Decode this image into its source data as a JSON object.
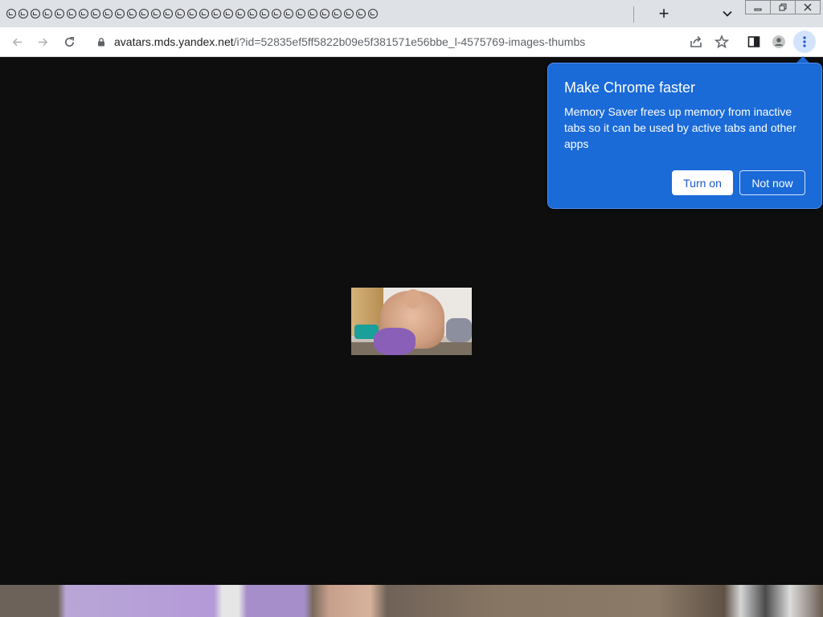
{
  "browser": {
    "tab_count": 31,
    "tab_favicon": "shield-swirl-icon",
    "new_tab_label": "+",
    "url_host": "avatars.mds.yandex.net",
    "url_path": "/i?id=52835ef5ff5822b09e5f381571e56bbe_l-4575769-images-thumbs"
  },
  "icons": {
    "back": "arrow-left-icon",
    "forward": "arrow-right-icon",
    "reload": "reload-icon",
    "lock": "lock-icon",
    "share": "share-icon",
    "bookmark": "star-icon",
    "side_panel": "side-panel-icon",
    "profile": "profile-icon",
    "menu": "three-dots-vertical-icon",
    "tab_search": "chevron-down-icon",
    "minimize": "minimize-icon",
    "restore": "restore-icon",
    "close": "close-icon"
  },
  "popup": {
    "title": "Make Chrome faster",
    "body": "Memory Saver frees up memory from inactive tabs so it can be used by active tabs and other apps",
    "primary_button": "Turn on",
    "secondary_button": "Not now"
  },
  "colors": {
    "popup_bg": "#1a6ad8",
    "page_bg": "#0e0e0e",
    "tabstrip_bg": "#dee1e6"
  }
}
